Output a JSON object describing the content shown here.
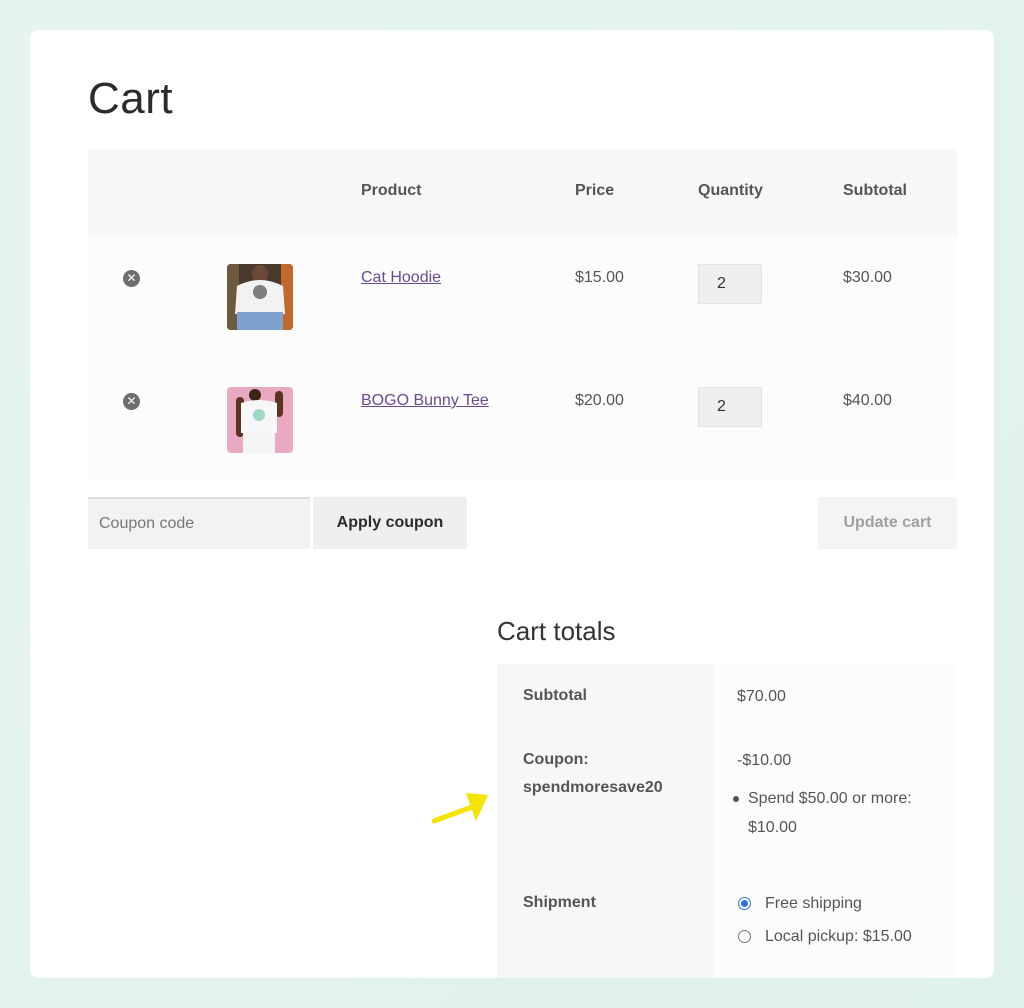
{
  "page": {
    "title": "Cart"
  },
  "table": {
    "headers": {
      "product": "Product",
      "price": "Price",
      "quantity": "Quantity",
      "subtotal": "Subtotal"
    },
    "rows": [
      {
        "name": "Cat Hoodie",
        "price": "$15.00",
        "quantity": "2",
        "subtotal": "$30.00",
        "thumb": "hoodie-thumbnail"
      },
      {
        "name": "BOGO Bunny Tee",
        "price": "$20.00",
        "quantity": "2",
        "subtotal": "$40.00",
        "thumb": "tee-thumbnail"
      }
    ],
    "remove_icon": "remove-item-icon"
  },
  "actions": {
    "coupon_placeholder": "Coupon code",
    "apply_label": "Apply coupon",
    "update_label": "Update cart"
  },
  "totals": {
    "title": "Cart totals",
    "subtotal_label": "Subtotal",
    "subtotal_value": "$70.00",
    "coupon_label": "Coupon:",
    "coupon_code": "spendmoresave20",
    "coupon_value": "-$10.00",
    "coupon_note_line1": "Spend $50.00 or more:",
    "coupon_note_line2": "$10.00",
    "shipment_label": "Shipment",
    "shipping_options": [
      {
        "label": "Free shipping",
        "selected": true
      },
      {
        "label": "Local pickup: $15.00",
        "selected": false
      }
    ]
  },
  "colors": {
    "link": "#6a4a8f",
    "radio_selected": "#2f6fe8",
    "annotation_arrow": "#f5e400"
  }
}
